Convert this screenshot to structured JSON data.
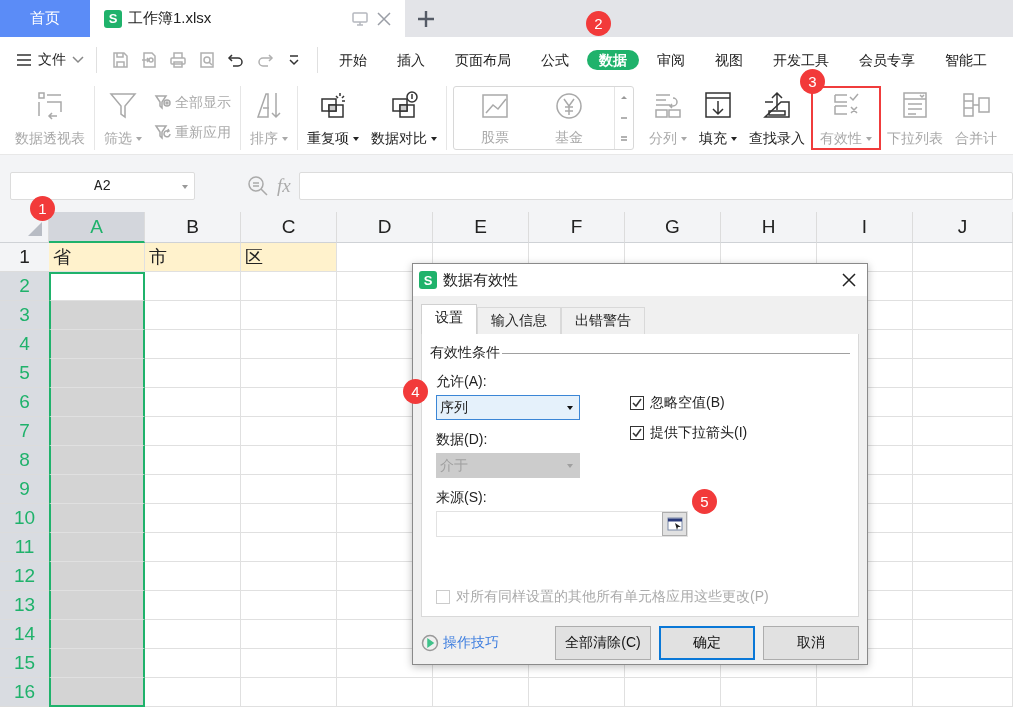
{
  "tabs": [
    {
      "kind": "home",
      "label": "首页",
      "selected": false
    },
    {
      "kind": "file",
      "logo": "S",
      "label": "工作簿1.xlsx",
      "selected": true
    }
  ],
  "menu": {
    "file": "文件",
    "quick_access": [
      {
        "disabled": true
      },
      {
        "disabled": true
      },
      {
        "disabled": true
      },
      {
        "disabled": true
      },
      {
        "disabled": false
      },
      {
        "disabled": true
      },
      {
        "disabled": false
      }
    ],
    "tabs": [
      {
        "label": "开始",
        "selected": false
      },
      {
        "label": "插入",
        "selected": false
      },
      {
        "label": "页面布局",
        "selected": false
      },
      {
        "label": "公式",
        "selected": false
      },
      {
        "label": "数据",
        "selected": true
      },
      {
        "label": "审阅",
        "selected": false
      },
      {
        "label": "视图",
        "selected": false
      },
      {
        "label": "开发工具",
        "selected": false
      },
      {
        "label": "会员专享",
        "selected": false
      },
      {
        "label": "智能工",
        "selected": false
      }
    ]
  },
  "ribbon": [
    {
      "kind": "plain",
      "items": [
        {
          "kind": "large",
          "label": "数据透视表",
          "disabled": true,
          "dropdown": false,
          "highlighted": false
        }
      ]
    },
    {
      "kind": "plain",
      "items": [
        {
          "kind": "large",
          "label": "筛选",
          "disabled": true,
          "dropdown": true,
          "highlighted": false
        },
        {
          "kind": "small",
          "label": "全部显示",
          "disabled": true,
          "dropdown": false,
          "highlighted": false
        },
        {
          "kind": "small",
          "label": "重新应用",
          "disabled": true,
          "dropdown": false,
          "highlighted": false
        }
      ]
    },
    {
      "kind": "plain",
      "items": [
        {
          "kind": "large",
          "label": "排序",
          "disabled": true,
          "dropdown": true,
          "highlighted": false
        }
      ]
    },
    {
      "kind": "plain",
      "items": [
        {
          "kind": "large",
          "label": "重复项",
          "disabled": false,
          "dropdown": true,
          "highlighted": false
        },
        {
          "kind": "large",
          "label": "数据对比",
          "disabled": false,
          "dropdown": true,
          "highlighted": false
        }
      ]
    },
    {
      "kind": "gallery",
      "items": [
        {
          "kind": "large",
          "label": "股票",
          "disabled": true,
          "dropdown": false,
          "highlighted": false
        },
        {
          "kind": "large",
          "label": "基金",
          "disabled": true,
          "dropdown": false,
          "highlighted": false
        }
      ]
    },
    {
      "kind": "plain",
      "items": [
        {
          "kind": "large",
          "label": "分列",
          "disabled": true,
          "dropdown": true,
          "highlighted": false
        },
        {
          "kind": "large",
          "label": "填充",
          "disabled": false,
          "dropdown": true,
          "highlighted": false
        },
        {
          "kind": "large",
          "label": "查找录入",
          "disabled": false,
          "dropdown": false,
          "highlighted": false
        },
        {
          "kind": "large",
          "label": "有效性",
          "disabled": true,
          "dropdown": true,
          "highlighted": true
        },
        {
          "kind": "large",
          "label": "下拉列表",
          "disabled": true,
          "dropdown": false,
          "highlighted": false
        },
        {
          "kind": "large",
          "label": "合并计",
          "disabled": true,
          "dropdown": false,
          "highlighted": false
        }
      ]
    }
  ],
  "formula_bar": {
    "name_box": "A2",
    "function_label": "fx"
  },
  "sheet": {
    "columns": [
      {
        "label": "A",
        "selected": true
      },
      {
        "label": "B",
        "selected": false
      },
      {
        "label": "C",
        "selected": false
      },
      {
        "label": "D",
        "selected": false
      },
      {
        "label": "E",
        "selected": false
      },
      {
        "label": "F",
        "selected": false
      },
      {
        "label": "G",
        "selected": false
      },
      {
        "label": "H",
        "selected": false
      },
      {
        "label": "I",
        "selected": false
      },
      {
        "label": "J",
        "selected": false
      }
    ],
    "rows": [
      {
        "header": "1",
        "selected": false,
        "cells": [
          {
            "text": "省",
            "color": "#fff2cc"
          },
          {
            "text": "市",
            "color": "#fff2cc"
          },
          {
            "text": "区",
            "color": "#fff2cc"
          }
        ]
      },
      {
        "header": "2",
        "selected": true
      },
      {
        "header": "3",
        "selected": true
      },
      {
        "header": "4",
        "selected": true
      },
      {
        "header": "5",
        "selected": true
      },
      {
        "header": "6",
        "selected": true
      },
      {
        "header": "7",
        "selected": true
      },
      {
        "header": "8",
        "selected": true
      },
      {
        "header": "9",
        "selected": true
      },
      {
        "header": "10",
        "selected": true
      },
      {
        "header": "11",
        "selected": true
      },
      {
        "header": "12",
        "selected": true
      },
      {
        "header": "13",
        "selected": true
      },
      {
        "header": "14",
        "selected": true
      },
      {
        "header": "15",
        "selected": true
      },
      {
        "header": "16",
        "selected": true
      }
    ]
  },
  "dialog": {
    "logo": "S",
    "title": "数据有效性",
    "tabs": [
      {
        "label": "设置",
        "selected": true
      },
      {
        "label": "输入信息",
        "selected": false
      },
      {
        "label": "出错警告",
        "selected": false
      }
    ],
    "section": "有效性条件",
    "allow_label": "允许(A):",
    "allow_value": "序列",
    "data_label": "数据(D):",
    "data_value": "介于",
    "data_disabled": true,
    "options": [
      {
        "label": "忽略空值(B)",
        "checked": true
      },
      {
        "label": "提供下拉箭头(I)",
        "checked": true
      }
    ],
    "source_label": "来源(S):",
    "apply_all": {
      "label": "对所有同样设置的其他所有单元格应用这些更改(P)",
      "checked": false,
      "disabled": true
    },
    "tips_link": "操作技巧",
    "buttons": [
      {
        "label": "全部清除(C)",
        "default": false
      },
      {
        "label": "确定",
        "default": true
      },
      {
        "label": "取消",
        "default": false
      }
    ]
  },
  "annotations": [
    {
      "label": "1"
    },
    {
      "label": "2"
    },
    {
      "label": "3"
    },
    {
      "label": "4"
    },
    {
      "label": "5"
    }
  ]
}
